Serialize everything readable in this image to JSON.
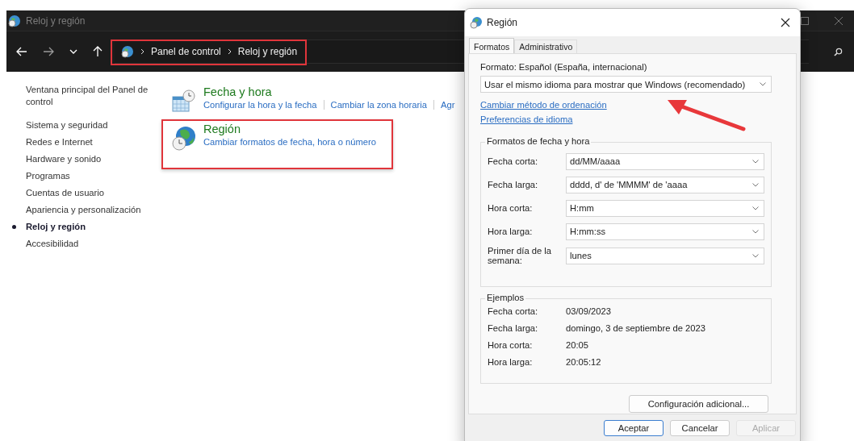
{
  "window": {
    "title": "Reloj y región"
  },
  "breadcrumb": [
    "Panel de control",
    "Reloj y región"
  ],
  "sidebar": {
    "items": [
      {
        "label": "Ventana principal del Panel de control",
        "selected": false
      },
      {
        "label": "Sistema y seguridad",
        "selected": false
      },
      {
        "label": "Redes e Internet",
        "selected": false
      },
      {
        "label": "Hardware y sonido",
        "selected": false
      },
      {
        "label": "Programas",
        "selected": false
      },
      {
        "label": "Cuentas de usuario",
        "selected": false
      },
      {
        "label": "Apariencia y personalización",
        "selected": false
      },
      {
        "label": "Reloj y región",
        "selected": true
      },
      {
        "label": "Accesibilidad",
        "selected": false
      }
    ]
  },
  "categories": [
    {
      "title": "Fecha y hora",
      "kind": "datetime",
      "links": [
        "Configurar la hora y la fecha",
        "Cambiar la zona horaria",
        "Agr"
      ]
    },
    {
      "title": "Región",
      "kind": "region",
      "links": [
        "Cambiar formatos de fecha, hora o número"
      ]
    }
  ],
  "dialog": {
    "title": "Región",
    "tabs": [
      {
        "label": "Formatos",
        "selected": true
      },
      {
        "label": "Administrativo",
        "selected": false
      }
    ],
    "format_label": "Formato: Español (España, internacional)",
    "format_value": "Usar el mismo idioma para mostrar que Windows (recomendado)",
    "links": [
      "Cambiar método de ordenación",
      "Preferencias de idioma"
    ],
    "formats_group": {
      "title": "Formatos de fecha y hora",
      "fields": [
        {
          "label": "Fecha corta:",
          "value": "dd/MM/aaaa"
        },
        {
          "label": "Fecha larga:",
          "value": "dddd, d' de 'MMMM' de 'aaaa"
        },
        {
          "label": "Hora corta:",
          "value": "H:mm"
        },
        {
          "label": "Hora larga:",
          "value": "H:mm:ss"
        },
        {
          "label": "Primer día de la semana:",
          "value": "lunes"
        }
      ]
    },
    "examples_group": {
      "title": "Ejemplos",
      "rows": [
        {
          "label": "Fecha corta:",
          "value": "03/09/2023"
        },
        {
          "label": "Fecha larga:",
          "value": "domingo, 3 de septiembre de 2023"
        },
        {
          "label": "Hora corta:",
          "value": "20:05"
        },
        {
          "label": "Hora larga:",
          "value": "20:05:12"
        }
      ]
    },
    "additional_button": "Configuración adicional...",
    "buttons": [
      {
        "label": "Aceptar",
        "kind": "default",
        "disabled": false
      },
      {
        "label": "Cancelar",
        "kind": "normal",
        "disabled": false
      },
      {
        "label": "Aplicar",
        "kind": "normal",
        "disabled": true
      }
    ]
  }
}
